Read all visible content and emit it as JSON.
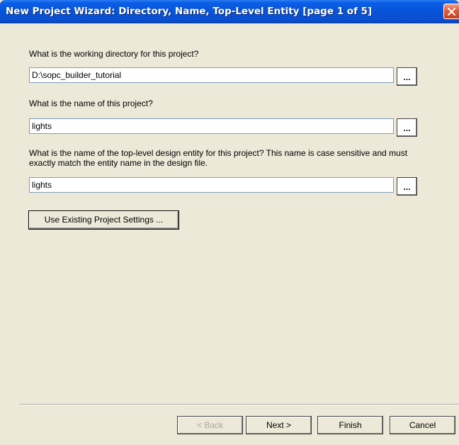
{
  "window": {
    "title": "New Project Wizard: Directory, Name, Top-Level Entity [page 1 of 5]",
    "close_icon": "close-icon"
  },
  "fields": {
    "directory": {
      "label": "What is the working directory for this project?",
      "value": "D:\\sopc_builder_tutorial",
      "browse_label": "..."
    },
    "project_name": {
      "label": "What is the name of this project?",
      "value": "lights",
      "browse_label": "..."
    },
    "top_level_entity": {
      "label": "What is the name of the top-level design entity for this project? This name is case sensitive and must exactly match the entity name in the design file.",
      "value": "lights",
      "browse_label": "..."
    }
  },
  "existing_settings_label": "Use Existing Project Settings ...",
  "footer": {
    "back_label": "< Back",
    "next_label": "Next >",
    "finish_label": "Finish",
    "cancel_label": "Cancel"
  },
  "colors": {
    "titlebar": "#0853d8",
    "dialog_bg": "#ece9d8",
    "close_button": "#e25a35",
    "disabled_text": "#aca899"
  }
}
